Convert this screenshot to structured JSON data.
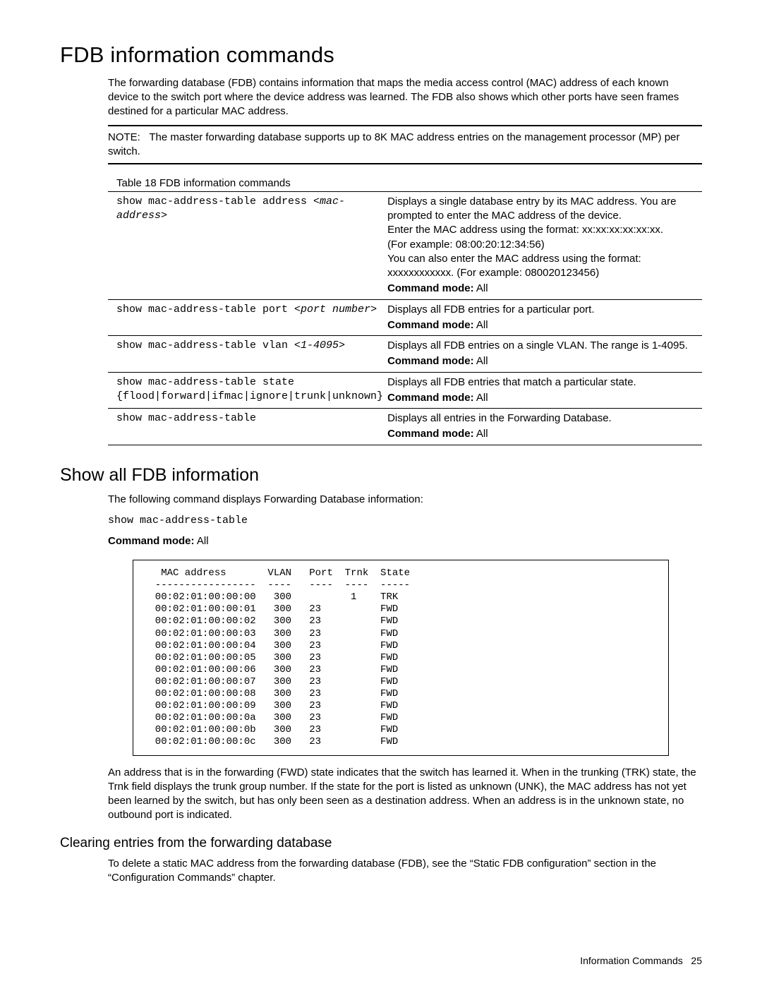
{
  "heading_main": "FDB information commands",
  "intro_para": "The forwarding database (FDB) contains information that maps the media access control (MAC) address of each known device to the switch port where the device address was learned. The FDB also shows which other ports have seen frames destined for a particular MAC address.",
  "note_label": "NOTE:",
  "note_body": "The master forwarding database supports up to 8K MAC address entries on the management processor (MP) per switch.",
  "table_caption": "Table 18  FDB information commands",
  "cmd_mode_label": "Command mode:",
  "cmd_mode_value": "All",
  "rows": [
    {
      "cmd_plain": "show mac-address-table address ",
      "cmd_italic": "<mac-address>",
      "desc_lines": [
        "Displays a single database entry by its MAC address. You are prompted to enter the MAC address of the device.",
        "Enter the MAC address using the format: xx:xx:xx:xx:xx:xx.",
        "(For example: 08:00:20:12:34:56)",
        "You can also enter the MAC address using the format: xxxxxxxxxxxx. (For example: 080020123456)"
      ]
    },
    {
      "cmd_plain": "show mac-address-table port ",
      "cmd_italic": "<port number>",
      "desc_lines": [
        "Displays all FDB entries for a particular port."
      ]
    },
    {
      "cmd_plain": "show mac-address-table vlan ",
      "cmd_italic": "<1-4095>",
      "desc_lines": [
        "Displays all FDB entries on a single VLAN. The range is 1-4095."
      ]
    },
    {
      "cmd_plain": "show mac-address-table state {flood|forward|ifmac|ignore|trunk|unknown}",
      "cmd_italic": "",
      "desc_lines": [
        "Displays all FDB entries that match a particular state."
      ]
    },
    {
      "cmd_plain": "show mac-address-table",
      "cmd_italic": "",
      "desc_lines": [
        "Displays all entries in the Forwarding Database."
      ]
    }
  ],
  "heading_show_all": "Show all FDB information",
  "show_all_intro": "The following command displays Forwarding Database information:",
  "show_all_cmd": "show mac-address-table",
  "output_text": "   MAC address       VLAN   Port  Trnk  State\n  -----------------  ----   ----  ----  -----\n  00:02:01:00:00:00   300          1    TRK\n  00:02:01:00:00:01   300   23          FWD\n  00:02:01:00:00:02   300   23          FWD\n  00:02:01:00:00:03   300   23          FWD\n  00:02:01:00:00:04   300   23          FWD\n  00:02:01:00:00:05   300   23          FWD\n  00:02:01:00:00:06   300   23          FWD\n  00:02:01:00:00:07   300   23          FWD\n  00:02:01:00:00:08   300   23          FWD\n  00:02:01:00:00:09   300   23          FWD\n  00:02:01:00:00:0a   300   23          FWD\n  00:02:01:00:00:0b   300   23          FWD\n  00:02:01:00:00:0c   300   23          FWD",
  "explain_para": "An address that is in the forwarding (FWD) state indicates that the switch has learned it. When in the trunking (TRK) state, the Trnk field displays the trunk group number. If the state for the port is listed as unknown (UNK), the MAC address has not yet been learned by the switch, but has only been seen as a destination address. When an address is in the unknown state, no outbound port is indicated.",
  "heading_clearing": "Clearing entries from the forwarding database",
  "clearing_para": "To delete a static MAC address from the forwarding database (FDB), see the “Static FDB configuration” section in the “Configuration Commands” chapter.",
  "footer_label": "Information Commands",
  "footer_page": "25"
}
